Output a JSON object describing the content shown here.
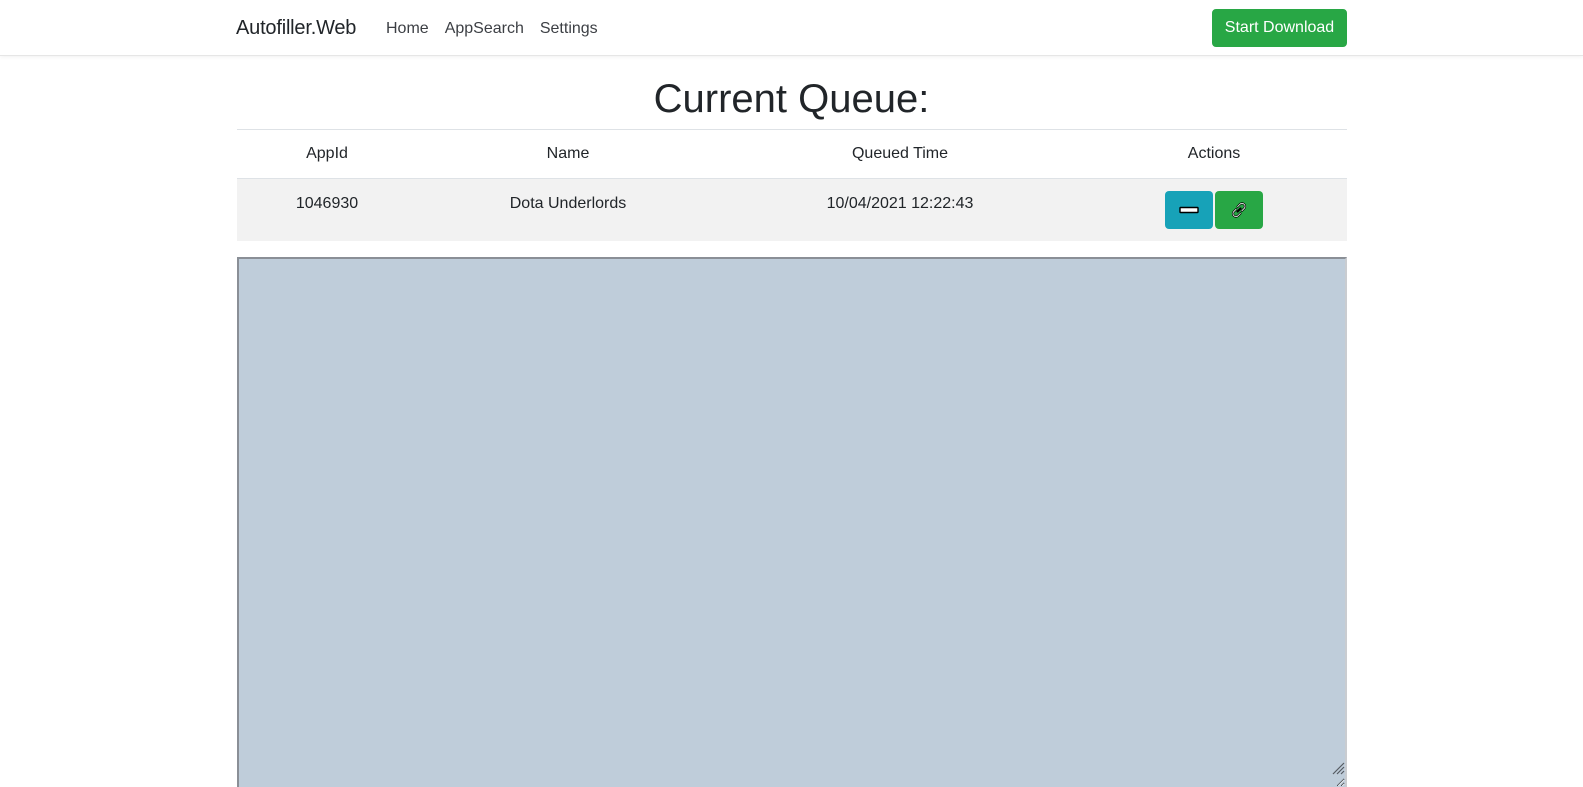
{
  "navbar": {
    "brand": "Autofiller.Web",
    "links": [
      "Home",
      "AppSearch",
      "Settings"
    ],
    "start_button": "Start Download"
  },
  "page": {
    "title": "Current Queue:"
  },
  "table": {
    "headers": [
      "AppId",
      "Name",
      "Queued Time",
      "Actions"
    ],
    "rows": [
      {
        "app_id": "1046930",
        "name": "Dota Underlords",
        "queued_time": "10/04/2021 12:22:43",
        "actions": [
          "minus-icon",
          "link-icon"
        ]
      }
    ]
  },
  "log": {
    "value": ""
  },
  "colors": {
    "success": "#28a745",
    "info": "#17a2b8",
    "log_background": "#bfcdda"
  }
}
